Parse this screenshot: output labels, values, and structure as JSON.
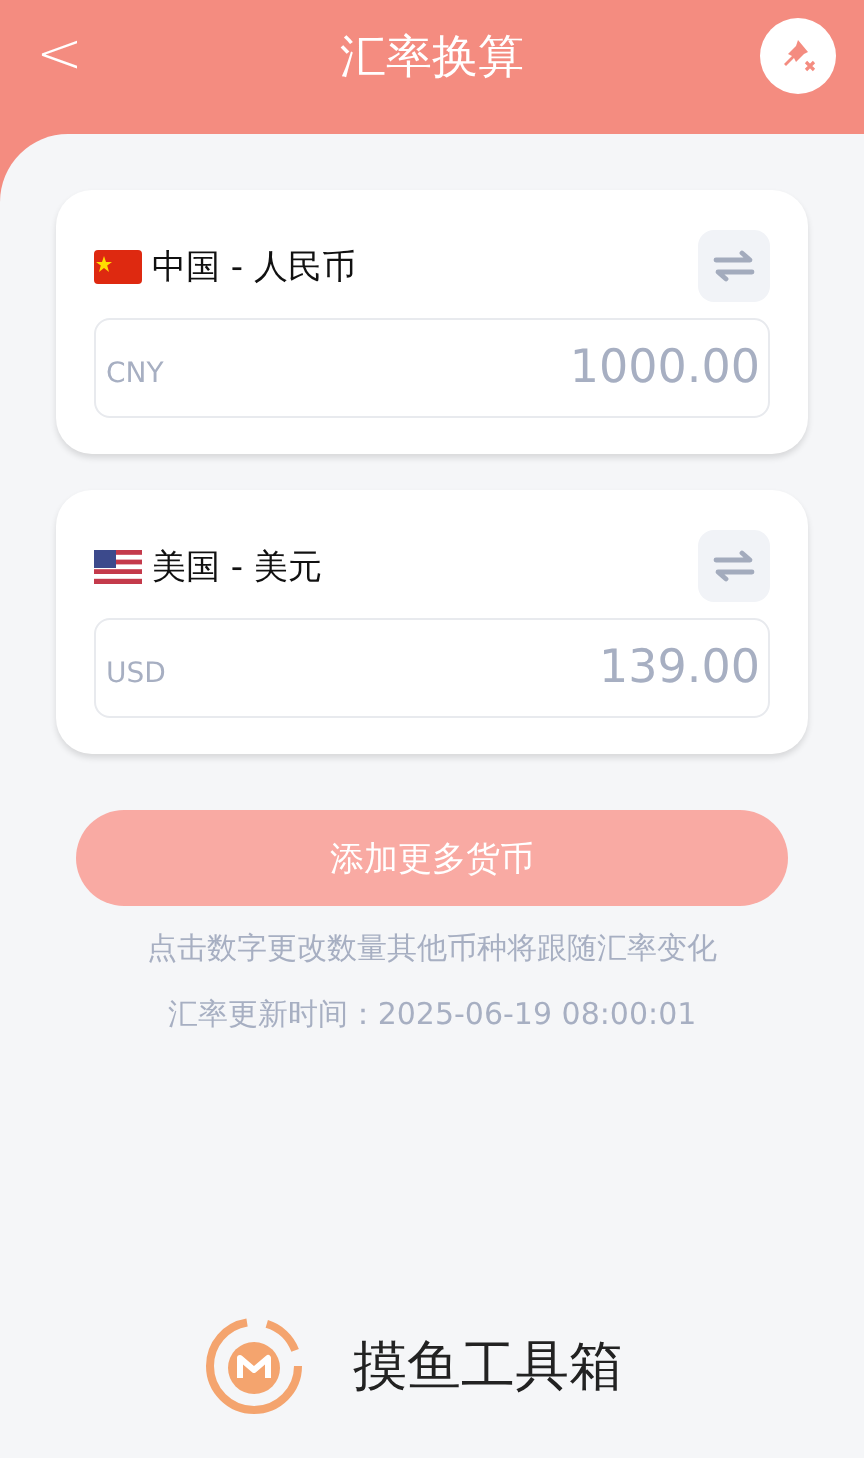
{
  "header": {
    "back": "<",
    "title": "汇率换算"
  },
  "currencies": [
    {
      "name": "中国 - 人民币",
      "code": "CNY",
      "value": "1000.00"
    },
    {
      "name": "美国 - 美元",
      "code": "USD",
      "value": "139.00"
    }
  ],
  "add_button": "添加更多货币",
  "hint": "点击数字更改数量其他币种将跟随汇率变化",
  "updated": "汇率更新时间：2025-06-19 08:00:01",
  "brand": "摸鱼工具箱"
}
